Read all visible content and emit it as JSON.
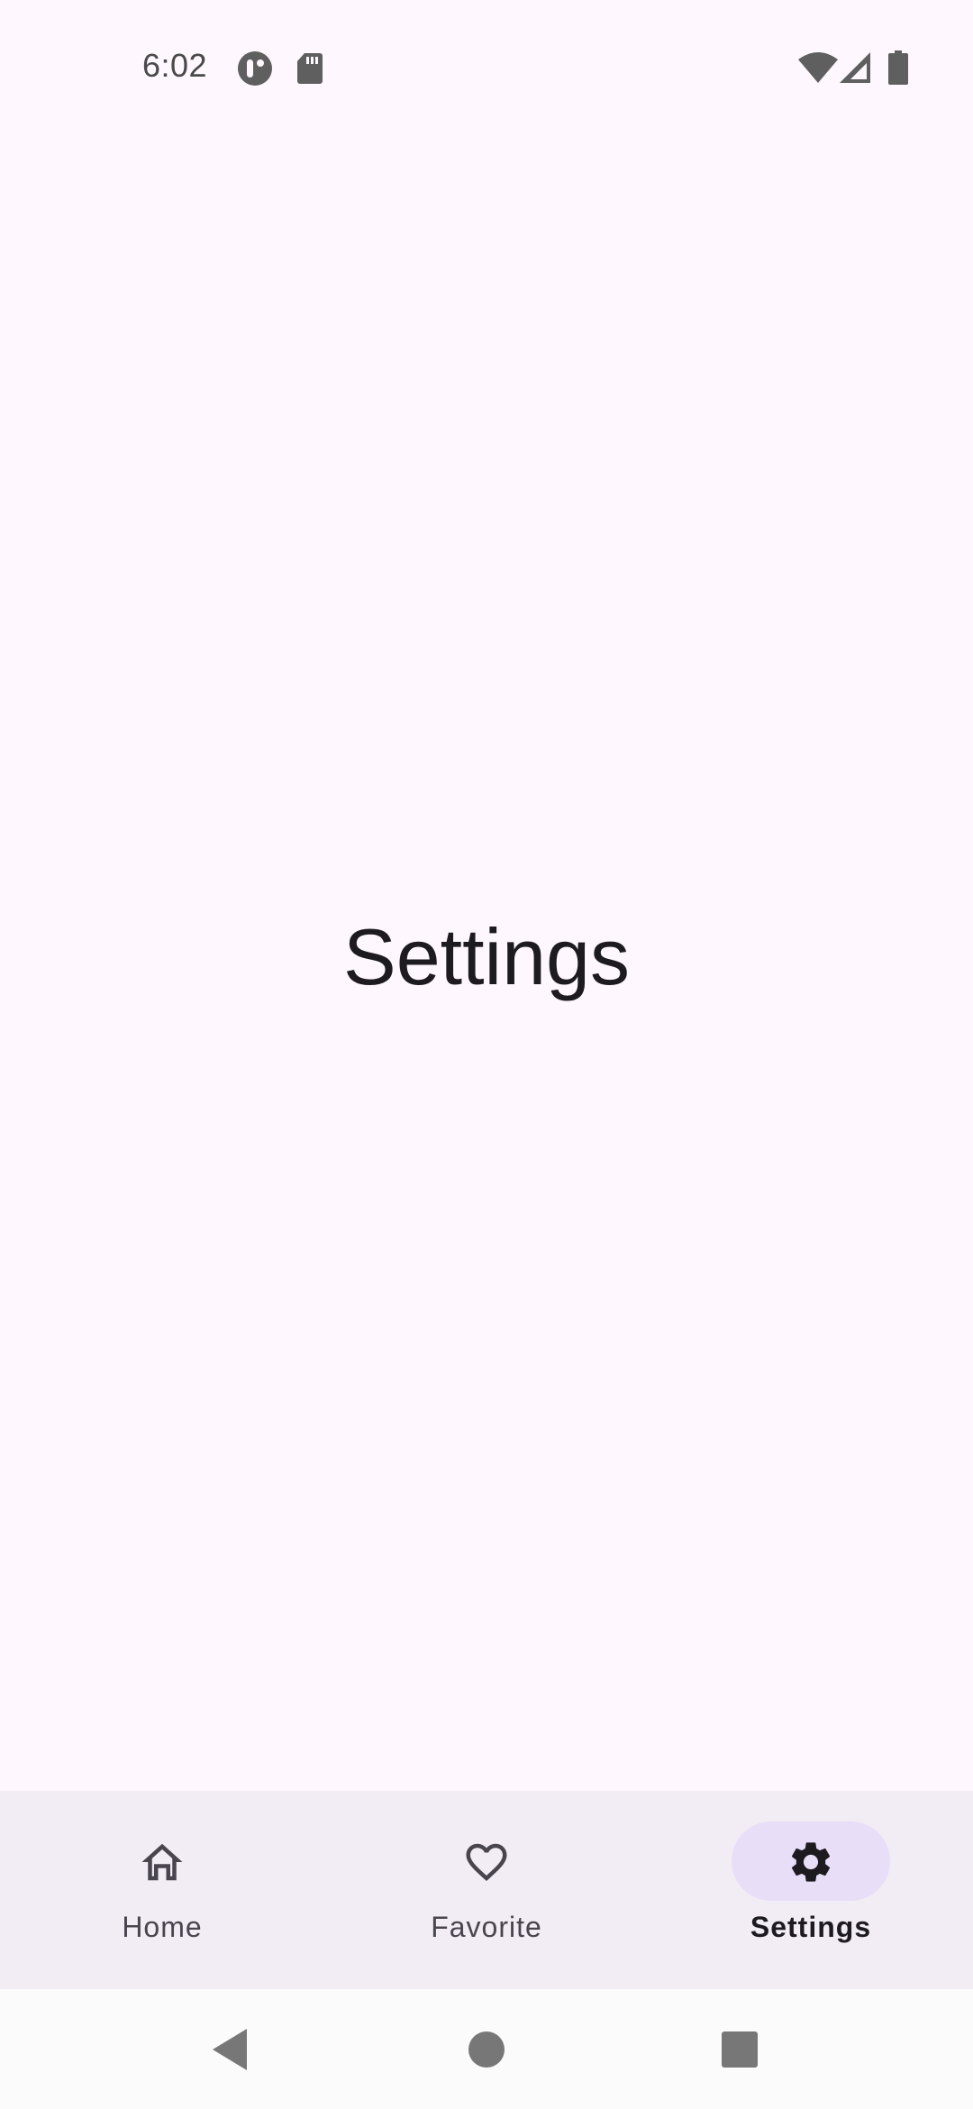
{
  "status_bar": {
    "time": "6:02",
    "icons_left": [
      "t-notification-icon",
      "sd-card-icon"
    ],
    "icons_right": [
      "wifi-icon",
      "cell-signal-icon",
      "battery-icon"
    ]
  },
  "main": {
    "title": "Settings"
  },
  "bottom_nav": {
    "items": [
      {
        "label": "Home",
        "icon": "home-icon",
        "active": false
      },
      {
        "label": "Favorite",
        "icon": "heart-icon",
        "active": false
      },
      {
        "label": "Settings",
        "icon": "gear-icon",
        "active": true
      }
    ]
  },
  "system_nav": {
    "buttons": [
      "back-icon",
      "home-circle-icon",
      "recents-icon"
    ]
  },
  "colors": {
    "background": "#fef7fd",
    "nav_bar": "#f2ecf4",
    "active_indicator": "#e8def8",
    "text_primary": "#1d1b20",
    "text_secondary": "#49454f"
  }
}
